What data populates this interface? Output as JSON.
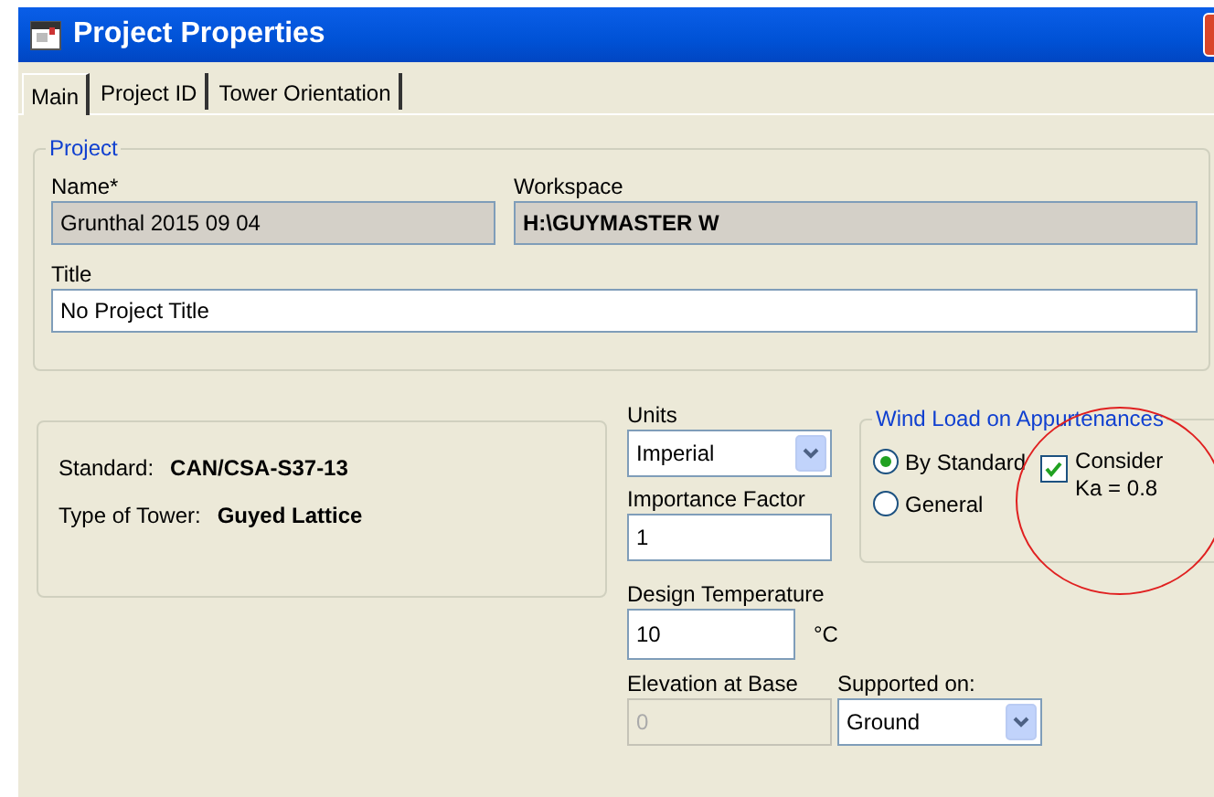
{
  "window": {
    "title": "Project Properties"
  },
  "tabs": [
    {
      "label": "Main",
      "selected": true
    },
    {
      "label": "Project ID",
      "selected": false
    },
    {
      "label": "Tower Orientation",
      "selected": false
    }
  ],
  "project_group": {
    "legend": "Project",
    "name": {
      "label": "Name*",
      "value": "Grunthal 2015 09 04",
      "readonly": true
    },
    "workspace": {
      "label": "Workspace",
      "value": "H:\\GUYMASTER W",
      "readonly": true
    },
    "title": {
      "label": "Title",
      "value": "No Project Title",
      "readonly": false
    }
  },
  "info": [
    {
      "label": "Standard:",
      "value": "CAN/CSA-S37-13"
    },
    {
      "label": "Type of Tower:",
      "value": "Guyed Lattice"
    }
  ],
  "units": {
    "label": "Units",
    "value": "Imperial"
  },
  "importance_factor": {
    "label": "Importance Factor",
    "value": "1"
  },
  "design_temperature": {
    "label": "Design Temperature",
    "value": "10",
    "unit": "°C"
  },
  "elevation": {
    "label": "Elevation at Base",
    "value": "0",
    "disabled": true
  },
  "supported_on": {
    "label": "Supported on:",
    "value": "Ground"
  },
  "wind_load": {
    "legend": "Wind Load on Appurtenances",
    "options": [
      {
        "label": "By Standard",
        "selected": true
      },
      {
        "label": "General",
        "selected": false
      }
    ],
    "consider": {
      "label": "Consider\nKa = 0.8",
      "checked": true
    }
  }
}
